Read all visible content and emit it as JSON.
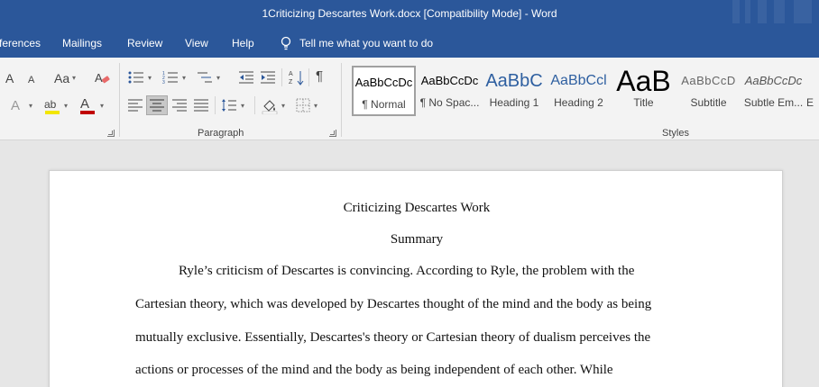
{
  "titlebar": {
    "title": "1Criticizing Descartes Work.docx [Compatibility Mode]  -  Word"
  },
  "menu": {
    "tabs": [
      "ferences",
      "Mailings",
      "Review",
      "View",
      "Help"
    ],
    "tell_me": "Tell me what you want to do"
  },
  "ribbon": {
    "font_group": {
      "grow_font": "A",
      "shrink_font": "A",
      "change_case": "Aa",
      "text_effects": "A",
      "highlight": "ab",
      "font_color": "A",
      "highlight_color": "#f2e600",
      "font_color_value": "#c00000"
    },
    "paragraph_group": {
      "label": "Paragraph",
      "pilcrow": "¶"
    },
    "styles_group": {
      "label": "Styles",
      "items": [
        {
          "sample": "AaBbCcDc",
          "name": "¶ Normal",
          "selected": true
        },
        {
          "sample": "AaBbCcDc",
          "name": "¶ No Spac..."
        },
        {
          "sample": "AaBbC",
          "name": "Heading 1"
        },
        {
          "sample": "AaBbCcl",
          "name": "Heading 2"
        },
        {
          "sample": "AaB",
          "name": "Title"
        },
        {
          "sample": "AaBbCcD",
          "name": "Subtitle"
        },
        {
          "sample": "AaBbCcDc",
          "name": "Subtle Em..."
        },
        {
          "sample": "",
          "name": "E"
        }
      ]
    }
  },
  "document": {
    "title": "Criticizing Descartes Work",
    "heading": "Summary",
    "lines": [
      "Ryle’s criticism of Descartes is convincing. According to Ryle, the problem with the",
      "Cartesian theory, which was developed by Descartes thought of the mind and the body as being",
      "mutually exclusive. Essentially, Descartes's theory or Cartesian theory of dualism perceives the",
      "actions or processes of the mind and the body as being independent of each other. While"
    ]
  }
}
